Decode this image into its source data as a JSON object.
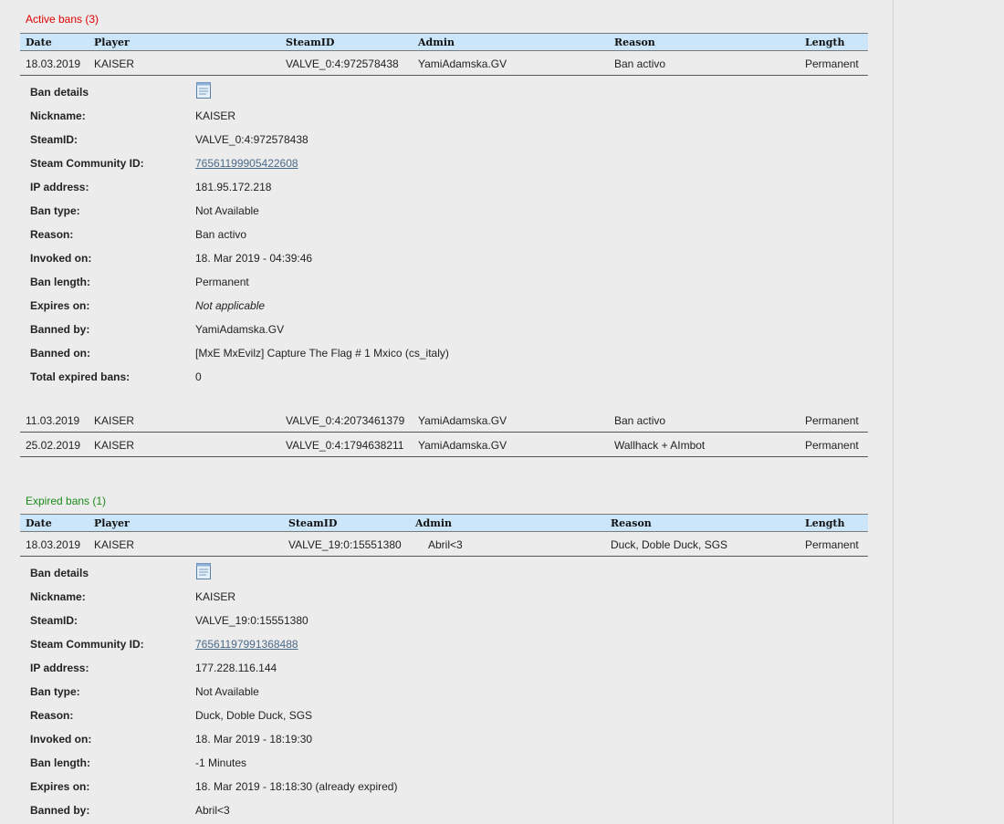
{
  "active": {
    "title": "Active bans (3)",
    "columns": [
      "Date",
      "Player",
      "SteamID",
      "Admin",
      "Reason",
      "Length"
    ],
    "rows": [
      {
        "date": "18.03.2019",
        "player": "KAISER",
        "steamid": "VALVE_0:4:972578438",
        "admin": "YamiAdamska.GV",
        "reason": "Ban activo",
        "length": "Permanent"
      },
      {
        "date": "11.03.2019",
        "player": "KAISER",
        "steamid": "VALVE_0:4:2073461379",
        "admin": "YamiAdamska.GV",
        "reason": "Ban activo",
        "length": "Permanent"
      },
      {
        "date": "25.02.2019",
        "player": "KAISER",
        "steamid": "VALVE_0:4:1794638211",
        "admin": "YamiAdamska.GV",
        "reason": "Wallhack + AImbot",
        "length": "Permanent"
      }
    ],
    "details": {
      "header": "Ban details",
      "icon": "document-icon",
      "fields": [
        {
          "label": "Nickname:",
          "value": "KAISER"
        },
        {
          "label": "SteamID:",
          "value": "VALVE_0:4:972578438"
        },
        {
          "label": "Steam Community ID:",
          "value": "76561199905422608"
        },
        {
          "label": "IP address:",
          "value": "181.95.172.218"
        },
        {
          "label": "Ban type:",
          "value": "Not Available"
        },
        {
          "label": "Reason:",
          "value": "Ban activo"
        },
        {
          "label": "Invoked on:",
          "value": "18. Mar 2019 - 04:39:46"
        },
        {
          "label": "Ban length:",
          "value": "Permanent"
        },
        {
          "label": "Expires on:",
          "value": "Not applicable"
        },
        {
          "label": "Banned by:",
          "value": "YamiAdamska.GV"
        },
        {
          "label": "Banned on:",
          "value": "[MxE MxEvilz] Capture The Flag # 1 Mxico (cs_italy)"
        },
        {
          "label": "Total expired bans:",
          "value": "0"
        }
      ]
    }
  },
  "expired": {
    "title": "Expired bans (1)",
    "columns": [
      "Date",
      "Player",
      "SteamID",
      "Admin",
      "Reason",
      "Length"
    ],
    "rows": [
      {
        "date": "18.03.2019",
        "player": "KAISER",
        "steamid": "VALVE_19:0:15551380",
        "admin": "Abril<3",
        "reason": "Duck, Doble Duck, SGS",
        "length": "Permanent"
      }
    ],
    "details": {
      "header": "Ban details",
      "icon": "document-icon",
      "fields": [
        {
          "label": "Nickname:",
          "value": "KAISER"
        },
        {
          "label": "SteamID:",
          "value": "VALVE_19:0:15551380"
        },
        {
          "label": "Steam Community ID:",
          "value": "76561197991368488"
        },
        {
          "label": "IP address:",
          "value": "177.228.116.144"
        },
        {
          "label": "Ban type:",
          "value": "Not Available"
        },
        {
          "label": "Reason:",
          "value": "Duck, Doble Duck, SGS"
        },
        {
          "label": "Invoked on:",
          "value": "18. Mar 2019 - 18:19:30"
        },
        {
          "label": "Ban length:",
          "value": "-1 Minutes"
        },
        {
          "label": "Expires on:",
          "value": "18. Mar 2019 - 18:18:30 (already expired)"
        },
        {
          "label": "Banned by:",
          "value": "Abril<3"
        }
      ]
    }
  },
  "colors": {
    "active_title": "#e00000",
    "expired_title": "#1a8a1a",
    "header_bg": "#cbe6fb",
    "link": "#4a6a8a",
    "page_bg": "#ececec"
  }
}
